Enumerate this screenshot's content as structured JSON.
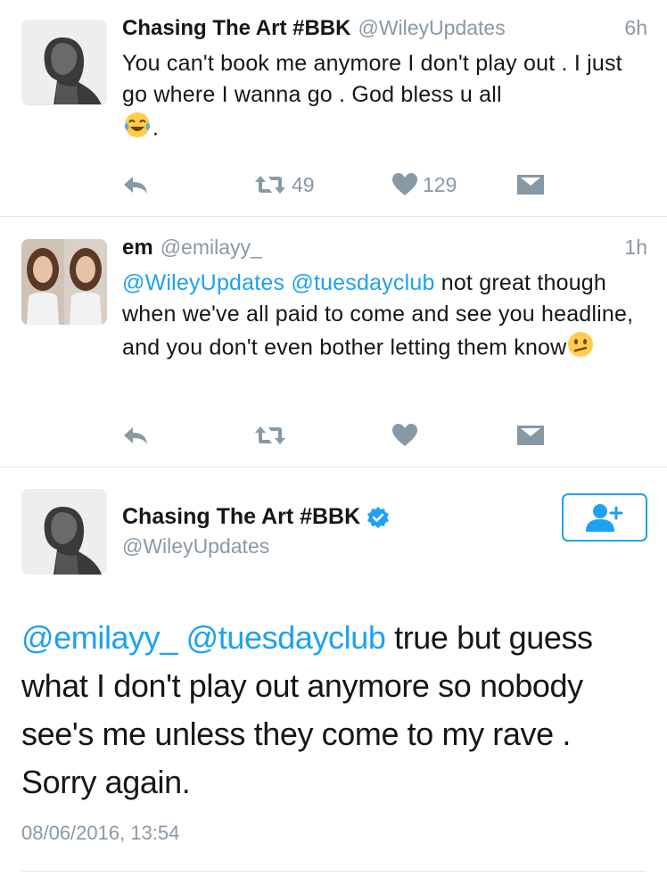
{
  "tweets": [
    {
      "name": "Chasing The Art #BBK",
      "handle": "@WileyUpdates",
      "time": "6h",
      "text": "You can't book me anymore I don't play out . I just go where I wanna go . God bless u all",
      "text_suffix": ".",
      "emoji": "tears-of-joy-emoji",
      "retweets": "49",
      "likes": "129"
    },
    {
      "name": "em",
      "handle": "@emilayy_",
      "time": "1h",
      "mentions": [
        "@WileyUpdates",
        "@tuesdayclub"
      ],
      "text": "not great though when we've all paid to come and see you headline, and you don't even bother letting them know",
      "emoji": "confused-face-emoji"
    }
  ],
  "main_tweet": {
    "name": "Chasing The Art #BBK",
    "handle": "@WileyUpdates",
    "mentions": [
      "@emilayy_",
      "@tuesdayclub"
    ],
    "text": "true but guess what I don't play out anymore so nobody see's me unless they come to my rave . Sorry again.",
    "timestamp": "08/06/2016, 13:54"
  },
  "colors": {
    "accent": "#1da1f2",
    "muted": "#8899a6",
    "text": "#14171a",
    "divider": "#e1e8ed"
  },
  "icons": [
    "reply-icon",
    "retweet-icon",
    "like-icon",
    "direct-message-icon",
    "verified-badge-icon",
    "follow-icon"
  ]
}
